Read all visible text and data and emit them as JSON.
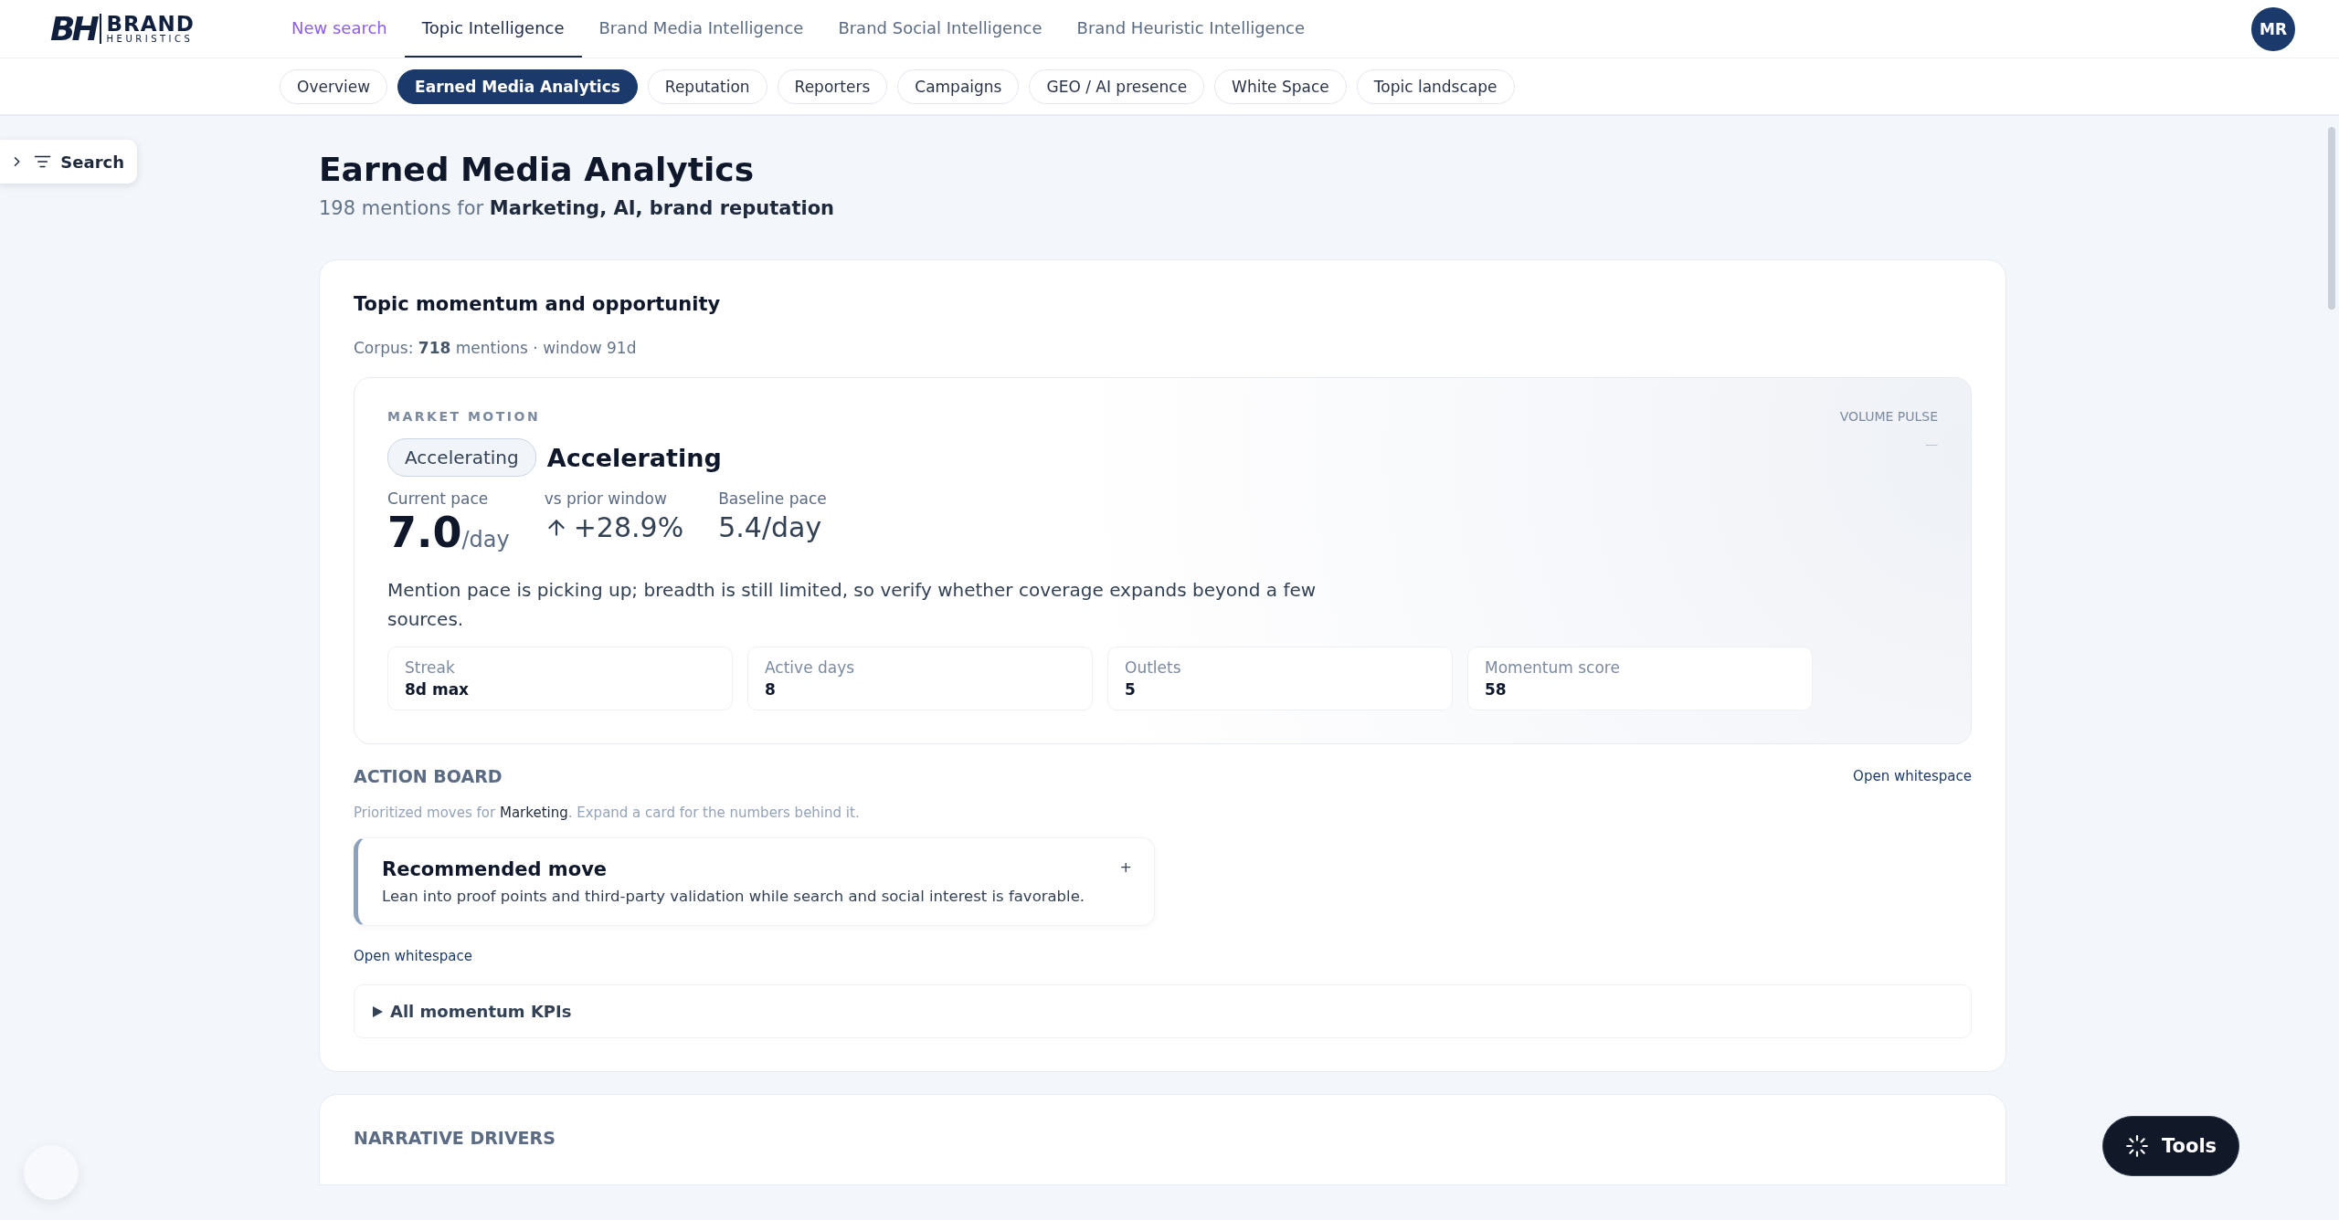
{
  "header": {
    "logo": {
      "mark": "BH",
      "name": "BRAND",
      "tagline": "HEURISTICS"
    },
    "nav": [
      {
        "label": "New search",
        "kind": "action",
        "selected": false
      },
      {
        "label": "Topic Intelligence",
        "kind": "link",
        "selected": true
      },
      {
        "label": "Brand Media Intelligence",
        "kind": "link",
        "selected": false
      },
      {
        "label": "Brand Social Intelligence",
        "kind": "link",
        "selected": false
      },
      {
        "label": "Brand Heuristic Intelligence",
        "kind": "link",
        "selected": false
      }
    ],
    "avatar": "MR"
  },
  "tabs": [
    {
      "label": "Overview",
      "selected": false
    },
    {
      "label": "Earned Media Analytics",
      "selected": true
    },
    {
      "label": "Reputation",
      "selected": false
    },
    {
      "label": "Reporters",
      "selected": false
    },
    {
      "label": "Campaigns",
      "selected": false
    },
    {
      "label": "GEO / AI presence",
      "selected": false
    },
    {
      "label": "White Space",
      "selected": false
    },
    {
      "label": "Topic landscape",
      "selected": false
    }
  ],
  "sidebar_toggle": {
    "label": "Search",
    "expanded": false
  },
  "page": {
    "title": "Earned Media Analytics",
    "subtitle": "198 mentions for **Marketing, AI, brand reputation**"
  },
  "momentum_card": {
    "title": "Topic momentum and opportunity",
    "corpus": "Corpus: **718** mentions · window 91d",
    "market_motion": {
      "eyebrow": "MARKET MOTION",
      "badge": "Accelerating",
      "status": "Accelerating",
      "volume_pulse": {
        "label": "VOLUME PULSE",
        "value": "—"
      },
      "metrics": [
        {
          "kind": "big",
          "label": "Current pace",
          "value": "7.0",
          "unit": "/day"
        },
        {
          "kind": "change",
          "label": "vs prior window",
          "value": "+28.9%"
        },
        {
          "kind": "plain",
          "label": "Baseline pace",
          "value": "5.4/day"
        }
      ],
      "summary": "Mention pace is picking up; breadth is still limited, so verify whether coverage expands beyond a few sources.",
      "stats": [
        {
          "label": "Streak",
          "value": "8d max"
        },
        {
          "label": "Active days",
          "value": "8"
        },
        {
          "label": "Outlets",
          "value": "5"
        },
        {
          "label": "Momentum score",
          "value": "58"
        }
      ]
    },
    "action_board": {
      "title": "ACTION BOARD",
      "link": "Open whitespace",
      "intro": "Prioritized moves for **Marketing**. Expand a card for the numbers behind it.",
      "moves": [
        {
          "title": "Recommended move",
          "text": "Lean into proof points and third-party validation while search and social interest is favorable.",
          "expander": "+",
          "expanded": false
        }
      ],
      "footer_link": "Open whitespace"
    },
    "kpis": {
      "label": "All momentum KPIs",
      "expanded": false
    }
  },
  "next_card": {
    "title": "NARRATIVE DRIVERS"
  },
  "tools_button": {
    "label": "Tools"
  }
}
